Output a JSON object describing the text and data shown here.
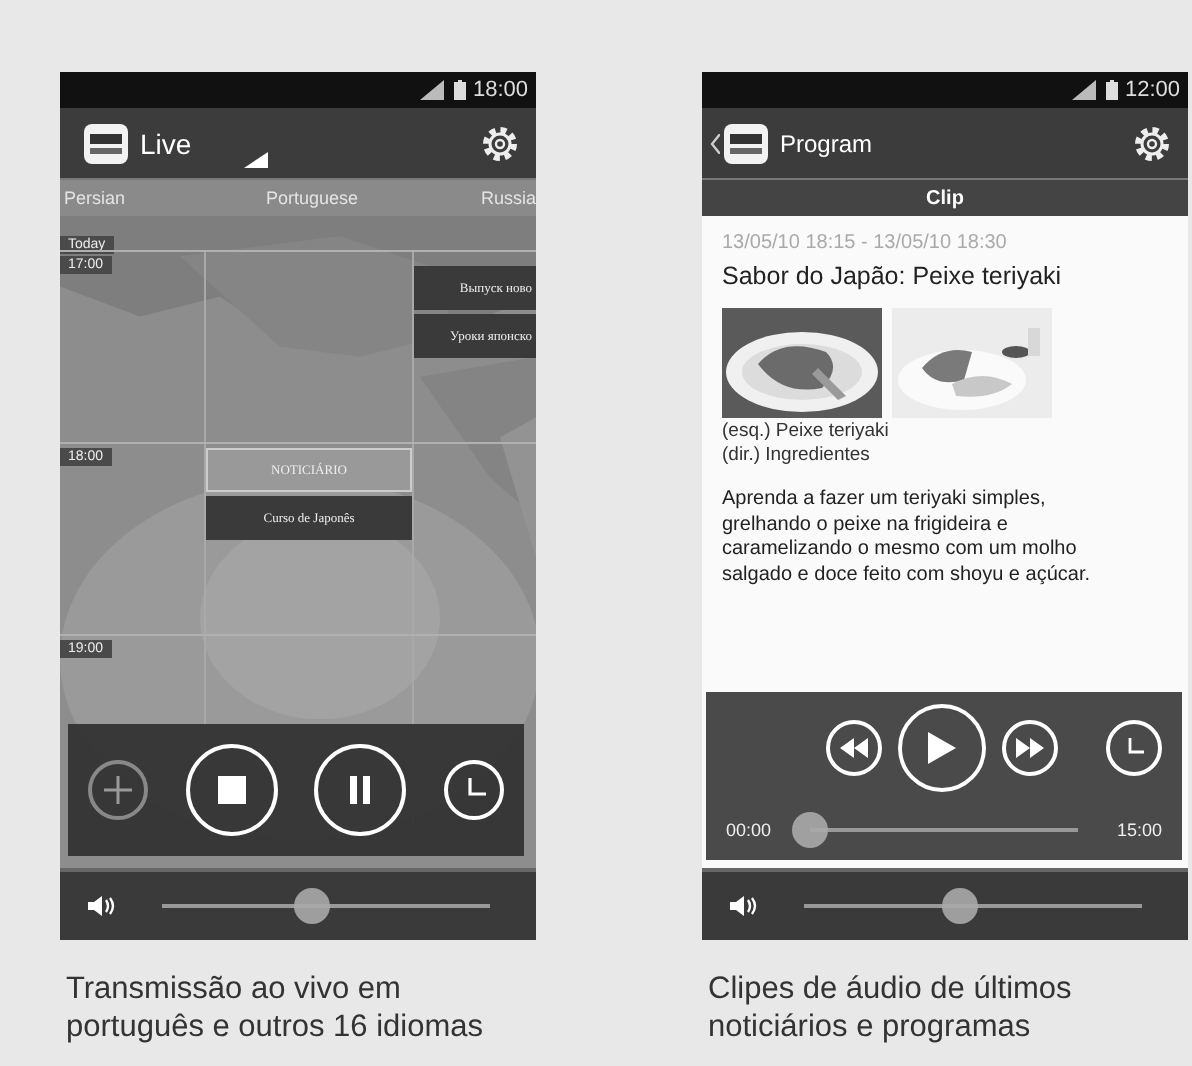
{
  "live_screen": {
    "status_time": "18:00",
    "title": "Live",
    "languages": [
      {
        "label": "Persian"
      },
      {
        "label": "Portuguese"
      },
      {
        "label": "Russia"
      }
    ],
    "day_label": "Today",
    "hours": [
      {
        "label": "17:00",
        "cells": [
          [],
          [],
          [
            {
              "text": "Выпуск ново",
              "kind": "dark"
            },
            {
              "text": "Уроки японско",
              "kind": "dark"
            }
          ]
        ]
      },
      {
        "label": "18:00",
        "cells": [
          [],
          [
            {
              "text": "NOTICIÁRIO",
              "kind": "light"
            },
            {
              "text": "Curso de Japonês",
              "kind": "dark"
            }
          ],
          []
        ]
      },
      {
        "label": "19:00",
        "cells": [
          [],
          [],
          []
        ]
      }
    ],
    "volume": {
      "level": 0.46
    }
  },
  "live_caption": "Transmissão ao vivo em português e outros 16 idiomas",
  "program_screen": {
    "status_time": "12:00",
    "title": "Program",
    "tab": "Clip",
    "date": "13/05/10 18:15 - 13/05/10 18:30",
    "heading": "Sabor do Japão: Peixe teriyaki",
    "photo_caption": [
      "(esq.) Peixe teriyaki",
      "(dir.) Ingredientes"
    ],
    "description": "Aprenda a fazer um teriyaki simples, grelhando o peixe na frigideira e caramelizando o mesmo com um molho salgado e doce feito com shoyu e açúcar.",
    "elapsed": "00:00",
    "duration": "15:00",
    "progress": {
      "level": 0
    },
    "volume": {
      "level": 0.46
    }
  },
  "program_caption": "Clipes de áudio de últimos noticiários e programas"
}
